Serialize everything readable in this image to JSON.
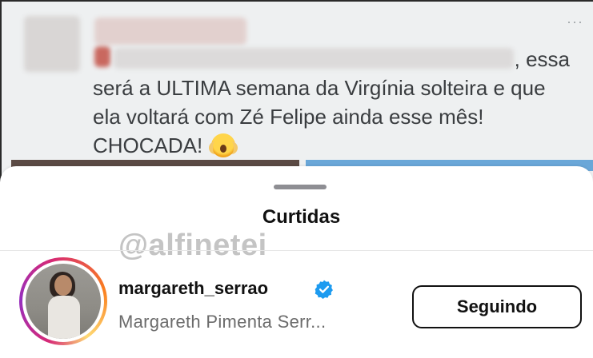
{
  "post": {
    "text_line1": ", essa",
    "text_line2": "será a ULTIMA semana da Virgínia solteira e que",
    "text_line3": "ela voltará com Zé Felipe ainda esse mês!",
    "text_line4": "CHOCADA!",
    "emoji": "screaming-face-emoji",
    "more_icon": "···"
  },
  "sheet": {
    "title": "Curtidas"
  },
  "watermark": "@alfinetei",
  "likes": [
    {
      "username": "margareth_serrao",
      "full_name": "Margareth Pimenta Serr...",
      "verified": true,
      "button_label": "Seguindo"
    }
  ],
  "colors": {
    "verified_badge": "#1d9bf0",
    "sheet_bg": "#ffffff",
    "secondary_text": "#6b6b6b"
  }
}
